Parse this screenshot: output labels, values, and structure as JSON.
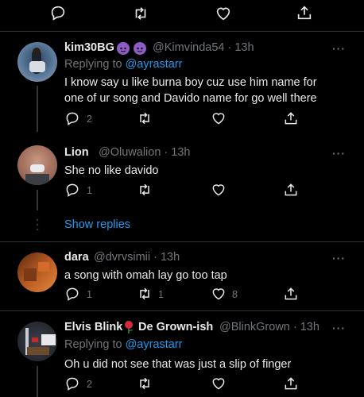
{
  "top_actions": {
    "reply_icon": "reply-icon",
    "retweet_icon": "retweet-icon",
    "like_icon": "like-icon",
    "share_icon": "share-icon"
  },
  "tweets": [
    {
      "name": "kim30BG",
      "name_emojis": [
        "purple-devil-emoji",
        "purple-devil-emoji"
      ],
      "handle": "@Kimvinda54 · 13h",
      "replying_label": "Replying to ",
      "replying_to": "@ayrastarr",
      "text": "I know say u like burna boy cuz use him name for one of ur song and Davido name for go well there",
      "reply_count": "2",
      "retweet_count": "",
      "like_count": ""
    },
    {
      "name": "Lion",
      "handle": "@Oluwalion · 13h",
      "text": "She no like davido",
      "reply_count": "1",
      "retweet_count": "",
      "like_count": ""
    },
    {
      "name": "dara",
      "handle": "@dvrvsimii · 13h",
      "text": "a song with omah lay go too tap",
      "reply_count": "1",
      "retweet_count": "1",
      "like_count": "8"
    },
    {
      "name": "Elvis Blink",
      "name_emoji": "rose-emoji",
      "name_suffix": "De Grown-ish",
      "handle": "@BlinkGrown · 13h",
      "replying_label": "Replying to ",
      "replying_to": "@ayrastarr",
      "text": "Oh u did not see that was just a slip of finger",
      "reply_count": "2",
      "retweet_count": "",
      "like_count": ""
    }
  ],
  "show_replies": "Show replies",
  "more_label": "···",
  "colors": {
    "background": "#000000",
    "text": "#e7e9ea",
    "secondary": "#71767b",
    "link": "#1d9bf0",
    "divider": "#2f3336"
  }
}
